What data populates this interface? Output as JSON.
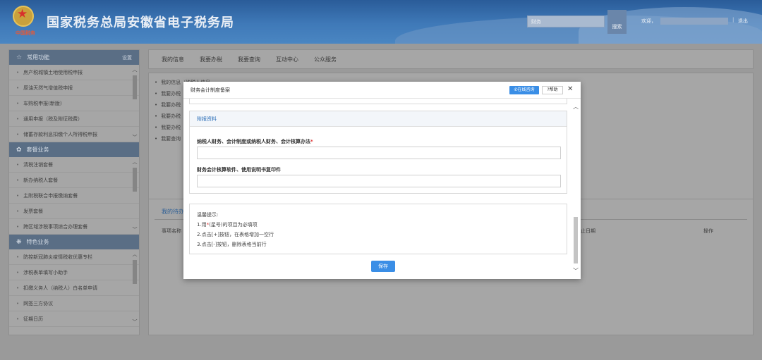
{
  "header": {
    "title": "国家税务总局安徽省电子税务局",
    "logo_text": "中国税务",
    "search_placeholder": "财务",
    "search_button": "搜索",
    "welcome": "欢迎，",
    "separator": "|",
    "logout": "退出"
  },
  "sidebar": {
    "common": {
      "title": "常用功能",
      "settings": "设置",
      "items": [
        "房产税城镇土地使用税申报",
        "原油天然气增值税申报",
        "车购税申报(新版)",
        "通用申报（税及附征税费）",
        "储蓄存款利息扣缴个人所得税申报"
      ]
    },
    "package": {
      "title": "套餐业务",
      "items": [
        "清税注销套餐",
        "新办纳税人套餐",
        "主附税联合申报缴纳套餐",
        "发票套餐",
        "跨区域涉税事项综合办理套餐"
      ]
    },
    "special": {
      "title": "特色业务",
      "items": [
        "防控新冠肺炎疫情税收优惠专栏",
        "涉税表单填写小助手",
        "扣缴义务人（纳税人）白名单申请",
        "网签三方协议",
        "征期日历"
      ]
    }
  },
  "main": {
    "nav": [
      "我的信息",
      "我要办税",
      "我要查询",
      "互动中心",
      "公众服务"
    ],
    "list_rows": [
      "我的信息",
      "我要办税",
      "我要办税",
      "我要办税",
      "我要办税",
      "我要查询"
    ],
    "list_row1_suffix": "（纳税人信息",
    "todo_tab": "我的待办",
    "todo_headers": {
      "name": "事项名称",
      "deadline": "止日期",
      "operation": "操作"
    }
  },
  "modal": {
    "title": "财务会计制度备案",
    "online_help": "在线咨询",
    "help": "帮助",
    "section_title": "附报资料",
    "field1_label": "纳税人财务、会计制度或纳税人财务、会计核算办法",
    "field1_required": "*",
    "field1_value": "",
    "field2_label": "财务会计核算软件、使用说明书复印件",
    "field2_value": "",
    "tips": {
      "title": "温馨提示:",
      "line1_pre": "1.用",
      "line1_star": "*",
      "line1_post": "(星号)的项目为必填项",
      "line2": "2.点击[+]按钮，在表格增加一空行",
      "line3": "3.点击[-]按钮，删除表格当前行"
    },
    "save": "保存"
  }
}
